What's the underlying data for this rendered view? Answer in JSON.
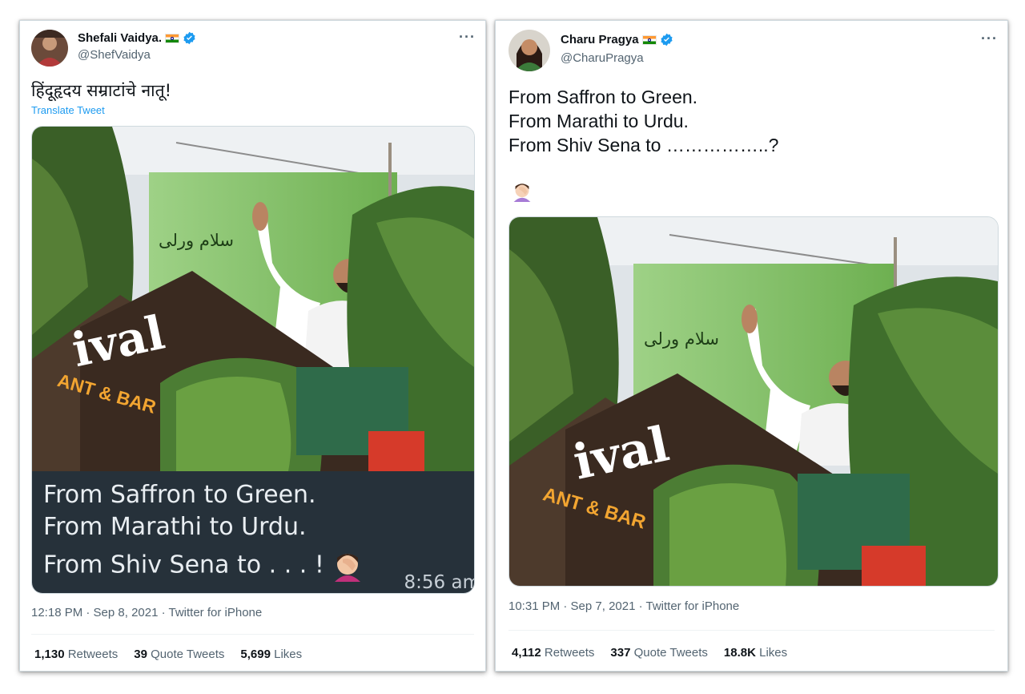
{
  "left_tweet": {
    "display_name": "Shefali Vaidya.",
    "handle": "@ShefVaidya",
    "text": "हिंदूहृदय सम्राटांचे नातू!",
    "translate_label": "Translate Tweet",
    "image_caption": {
      "line1": "From Saffron to Green.",
      "line2": "From Marathi to Urdu.",
      "line3": "From Shiv Sena to . . . !",
      "time": "8:56 am"
    },
    "billboard_text": "سلام ورلی",
    "sign_text": "ival",
    "sign_subtext": "ANT & BAR",
    "meta": "12:18 PM · Sep 8, 2021 · Twitter for iPhone",
    "stats": {
      "retweets_count": "1,130",
      "retweets_label": "Retweets",
      "quotes_count": "39",
      "quotes_label": "Quote Tweets",
      "likes_count": "5,699",
      "likes_label": "Likes"
    }
  },
  "right_tweet": {
    "display_name": "Charu Pragya",
    "handle": "@CharuPragya",
    "text_line1": "From Saffron to Green.",
    "text_line2": "From Marathi to Urdu.",
    "text_line3": "From Shiv Sena to ……………..?",
    "billboard_text": "سلام ورلی",
    "sign_text": "ival",
    "sign_subtext": "ANT & BAR",
    "meta": "10:31 PM · Sep 7, 2021 · Twitter for iPhone",
    "stats": {
      "retweets_count": "4,112",
      "retweets_label": "Retweets",
      "quotes_count": "337",
      "quotes_label": "Quote Tweets",
      "likes_count": "18.8K",
      "likes_label": "Likes"
    }
  },
  "icons": {
    "verified": "verified-badge-icon",
    "more": "more-options-icon",
    "flag": "india-flag-icon",
    "emoji": "facepalm-emoji"
  },
  "colors": {
    "link": "#1d9bf0",
    "secondary_text": "#536471",
    "billboard_green": "#7ec25e",
    "caption_bg": "#26313a"
  }
}
